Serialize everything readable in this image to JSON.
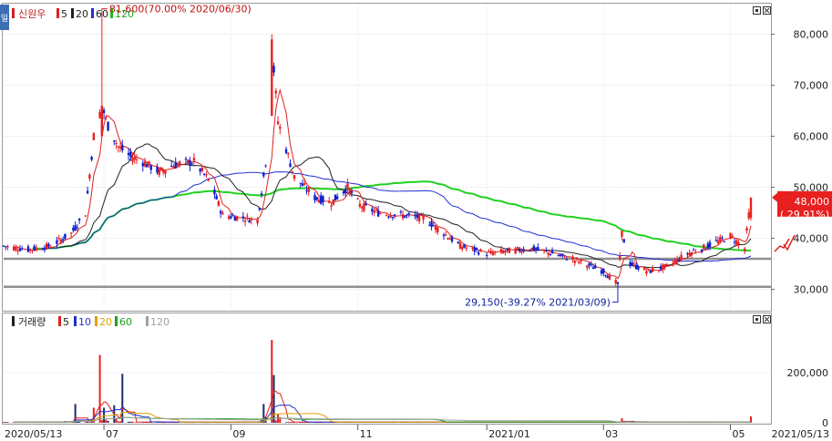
{
  "price_panel": {
    "title": "신원우",
    "legend": [
      {
        "label": "5",
        "color": "#e02020"
      },
      {
        "label": "20",
        "color": "#202020"
      },
      {
        "label": "60",
        "color": "#2030d0"
      },
      {
        "label": "120",
        "color": "#20c020"
      }
    ],
    "side_tab": "일",
    "high_annotation": "81,600(70.00% 2020/06/30)",
    "low_annotation": "29,150(-39.27% 2021/03/09)",
    "current_price": "48,000",
    "current_change": "( 29.91%)",
    "up_color": "#e82020",
    "down_color": "#1020d0",
    "ma_colors": {
      "ma5": "#e02020",
      "ma20": "#202020",
      "ma60": "#2030d0",
      "ma120": "#20d020"
    }
  },
  "volume_panel": {
    "title": "거래량",
    "legend": [
      {
        "label": "5",
        "color": "#e02020"
      },
      {
        "label": "10",
        "color": "#2030d0"
      },
      {
        "label": "20",
        "color": "#e0a000"
      },
      {
        "label": "60",
        "color": "#20a020"
      },
      {
        "label": "120",
        "color": "#a0a0a0"
      }
    ]
  },
  "x_axis": {
    "labels": [
      "2020/05/13",
      "07",
      "09",
      "11",
      "2021/01",
      "03",
      "05",
      "2021/05/13"
    ]
  },
  "chart_data": [
    {
      "type": "candlestick",
      "title": "신원우",
      "x_range": [
        "2020/05/13",
        "2021/05/13"
      ],
      "ylim": [
        26000,
        86000
      ],
      "y_ticks": [
        30000,
        40000,
        50000,
        60000,
        70000,
        80000
      ],
      "y_tick_labels": [
        "30,000",
        "40,000",
        "50,000",
        "60,000",
        "70,000",
        "80,000"
      ],
      "horizontal_lines": [
        36000,
        30500
      ],
      "annotations": [
        {
          "text": "81,600(70.00% 2020/06/30)",
          "x": "2020/06/30",
          "y": 81600
        },
        {
          "text": "29,150(-39.27% 2021/03/09)",
          "x": "2021/03/09",
          "y": 29150
        }
      ],
      "current": {
        "price": 48000,
        "change_pct": 29.91
      },
      "series": [
        {
          "name": "5",
          "ma_period": 5
        },
        {
          "name": "20",
          "ma_period": 20
        },
        {
          "name": "60",
          "ma_period": 60
        },
        {
          "name": "120",
          "ma_period": 120
        }
      ],
      "close_path": [
        [
          "2020/05/13",
          38500
        ],
        [
          "2020/05/25",
          37800
        ],
        [
          "2020/06/05",
          38500
        ],
        [
          "2020/06/15",
          41000
        ],
        [
          "2020/06/22",
          45000
        ],
        [
          "2020/06/26",
          60000
        ],
        [
          "2020/06/30",
          66000
        ],
        [
          "2020/07/03",
          62000
        ],
        [
          "2020/07/08",
          58000
        ],
        [
          "2020/07/14",
          56000
        ],
        [
          "2020/07/20",
          55000
        ],
        [
          "2020/07/28",
          53000
        ],
        [
          "2020/08/05",
          54500
        ],
        [
          "2020/08/14",
          55000
        ],
        [
          "2020/08/22",
          51000
        ],
        [
          "2020/08/28",
          44500
        ],
        [
          "2020/09/08",
          44000
        ],
        [
          "2020/09/14",
          43500
        ],
        [
          "2020/09/18",
          55000
        ],
        [
          "2020/09/21",
          78000
        ],
        [
          "2020/09/24",
          63000
        ],
        [
          "2020/10/02",
          52000
        ],
        [
          "2020/10/12",
          48000
        ],
        [
          "2020/10/20",
          47000
        ],
        [
          "2020/10/28",
          50000
        ],
        [
          "2020/11/03",
          46500
        ],
        [
          "2020/11/12",
          45000
        ],
        [
          "2020/11/24",
          44500
        ],
        [
          "2020/12/04",
          44000
        ],
        [
          "2020/12/14",
          41000
        ],
        [
          "2020/12/22",
          38500
        ],
        [
          "2021/01/04",
          37000
        ],
        [
          "2021/01/14",
          37500
        ],
        [
          "2021/01/26",
          38000
        ],
        [
          "2021/02/05",
          37000
        ],
        [
          "2021/02/18",
          35500
        ],
        [
          "2021/03/02",
          33500
        ],
        [
          "2021/03/09",
          31000
        ],
        [
          "2021/03/11",
          41000
        ],
        [
          "2021/03/15",
          35000
        ],
        [
          "2021/03/24",
          33500
        ],
        [
          "2021/04/02",
          34500
        ],
        [
          "2021/04/12",
          37000
        ],
        [
          "2021/04/22",
          38500
        ],
        [
          "2021/05/03",
          40500
        ],
        [
          "2021/05/10",
          38000
        ],
        [
          "2021/05/13",
          48000
        ]
      ]
    },
    {
      "type": "bar",
      "title": "거래량",
      "x_range": [
        "2020/05/13",
        "2021/05/13"
      ],
      "ylim": [
        0,
        370000
      ],
      "y_ticks": [
        0,
        200000
      ],
      "y_tick_labels": [
        "0",
        "200,000"
      ],
      "series": [
        {
          "name": "5",
          "ma_period": 5
        },
        {
          "name": "10",
          "ma_period": 10
        },
        {
          "name": "20",
          "ma_period": 20
        },
        {
          "name": "60",
          "ma_period": 60
        },
        {
          "name": "120",
          "ma_period": 120
        }
      ],
      "spikes": [
        [
          "2020/06/17",
          75000
        ],
        [
          "2020/06/26",
          60000
        ],
        [
          "2020/06/29",
          270000
        ],
        [
          "2020/07/01",
          60000
        ],
        [
          "2020/07/06",
          70000
        ],
        [
          "2020/07/10",
          195000
        ],
        [
          "2020/09/17",
          75000
        ],
        [
          "2020/09/21",
          330000
        ],
        [
          "2020/09/22",
          190000
        ],
        [
          "2021/03/11",
          18000
        ],
        [
          "2021/05/13",
          25000
        ]
      ]
    }
  ]
}
